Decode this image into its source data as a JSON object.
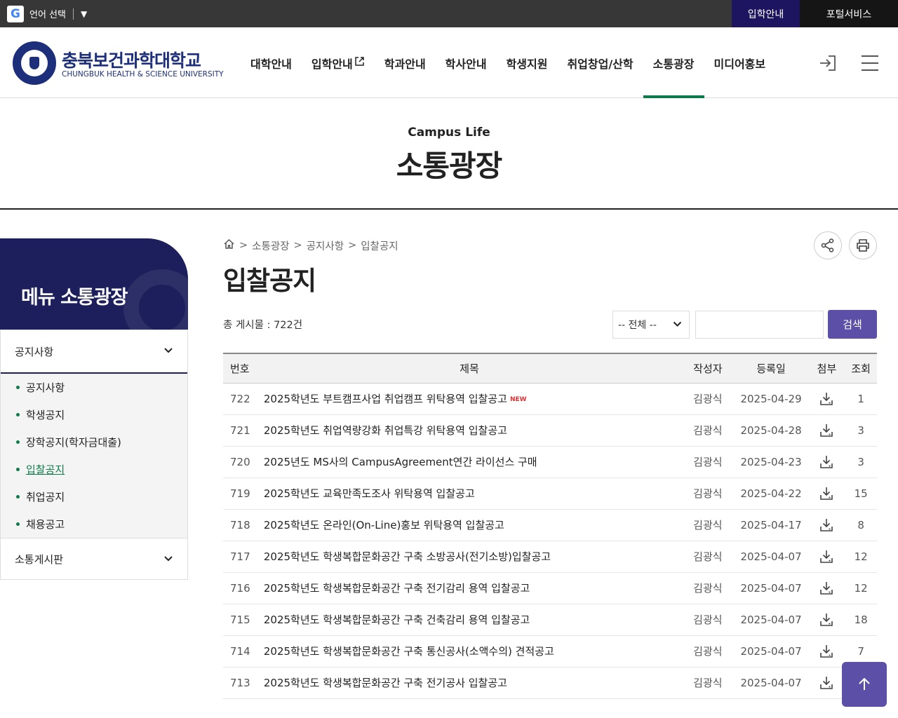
{
  "topbar": {
    "language_label": "언어 선택",
    "admission": "입학안내",
    "portal": "포털서비스"
  },
  "logo": {
    "name_ko": "충북보건과학대학교",
    "name_en": "CHUNGBUK HEALTH & SCIENCE UNIVERSITY"
  },
  "gnb": [
    {
      "label": "대학안내"
    },
    {
      "label": "입학안내"
    },
    {
      "label": "학과안내"
    },
    {
      "label": "학사안내"
    },
    {
      "label": "학생지원"
    },
    {
      "label": "취업창업/산학"
    },
    {
      "label": "소통광장"
    },
    {
      "label": "미디어홍보"
    }
  ],
  "banner": {
    "sub": "Campus Life",
    "title": "소통광장"
  },
  "lnb": {
    "title": "메뉴 소통광장",
    "section1": "공지사항",
    "items": [
      {
        "label": "공지사항"
      },
      {
        "label": "학생공지"
      },
      {
        "label": "장학공지(학자금대출)"
      },
      {
        "label": "입찰공지"
      },
      {
        "label": "취업공지"
      },
      {
        "label": "채용공고"
      }
    ],
    "section2": "소통게시판"
  },
  "breadcrumb": [
    "소통광장",
    "공지사항",
    "입찰공지"
  ],
  "page_title": "입찰공지",
  "total_label": "총 게시물 : 722건",
  "search": {
    "select_value": "-- 전체 --",
    "input_value": "",
    "button": "검색"
  },
  "table": {
    "headers": [
      "번호",
      "제목",
      "작성자",
      "등록일",
      "첨부",
      "조회"
    ],
    "new_badge": "NEW",
    "rows": [
      {
        "no": "722",
        "title": "2025학년도 부트캠프사업 취업캠프 위탁용역 입찰공고",
        "author": "김광식",
        "date": "2025-04-29",
        "views": "1"
      },
      {
        "no": "721",
        "title": "2025학년도 취업역량강화 취업특강 위탁용역 입찰공고",
        "author": "김광식",
        "date": "2025-04-28",
        "views": "3"
      },
      {
        "no": "720",
        "title": "2025년도 MS사의 CampusAgreement연간 라이선스 구매",
        "author": "김광식",
        "date": "2025-04-23",
        "views": "3"
      },
      {
        "no": "719",
        "title": "2025학년도 교육만족도조사 위탁용역 입찰공고",
        "author": "김광식",
        "date": "2025-04-22",
        "views": "15"
      },
      {
        "no": "718",
        "title": "2025학년도 온라인(On-Line)홍보 위탁용역 입찰공고",
        "author": "김광식",
        "date": "2025-04-17",
        "views": "8"
      },
      {
        "no": "717",
        "title": "2025학년도 학생복합문화공간 구축 소방공사(전기소방)입찰공고",
        "author": "김광식",
        "date": "2025-04-07",
        "views": "12"
      },
      {
        "no": "716",
        "title": "2025학년도 학생복합문화공간 구축 전기감리 용역 입찰공고",
        "author": "김광식",
        "date": "2025-04-07",
        "views": "12"
      },
      {
        "no": "715",
        "title": "2025학년도 학생복합문화공간 구축 건축감리 용역 입찰공고",
        "author": "김광식",
        "date": "2025-04-07",
        "views": "18"
      },
      {
        "no": "714",
        "title": "2025학년도 학생복합문화공간 구축 통신공사(소액수의) 견적공고",
        "author": "김광식",
        "date": "2025-04-07",
        "views": "7"
      },
      {
        "no": "713",
        "title": "2025학년도 학생복합문화공간 구축 전기공사 입찰공고",
        "author": "김광식",
        "date": "2025-04-07",
        "views": ""
      }
    ]
  },
  "colors": {
    "navy": "#1c1f5b",
    "green_active": "#0e7a4b",
    "search_button": "#5b4fa8"
  }
}
